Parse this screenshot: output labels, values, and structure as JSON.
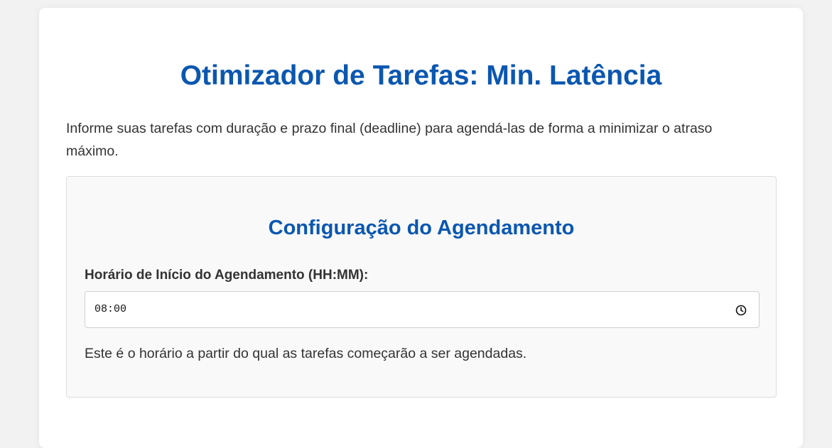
{
  "page": {
    "title": "Otimizador de Tarefas: Min. Latência",
    "intro": "Informe suas tarefas com duração e prazo final (deadline) para agendá-las de forma a minimizar o atraso máximo."
  },
  "config": {
    "title": "Configuração do Agendamento",
    "start_time_label": "Horário de Início do Agendamento (HH:MM):",
    "start_time_value": "08:00",
    "help_text": "Este é o horário a partir do qual as tarefas começarão a ser agendadas."
  },
  "icons": {
    "time_picker": "clock-icon"
  },
  "colors": {
    "accent": "#0b57b0",
    "text": "#333333",
    "panel_background": "#f9f9f9"
  }
}
